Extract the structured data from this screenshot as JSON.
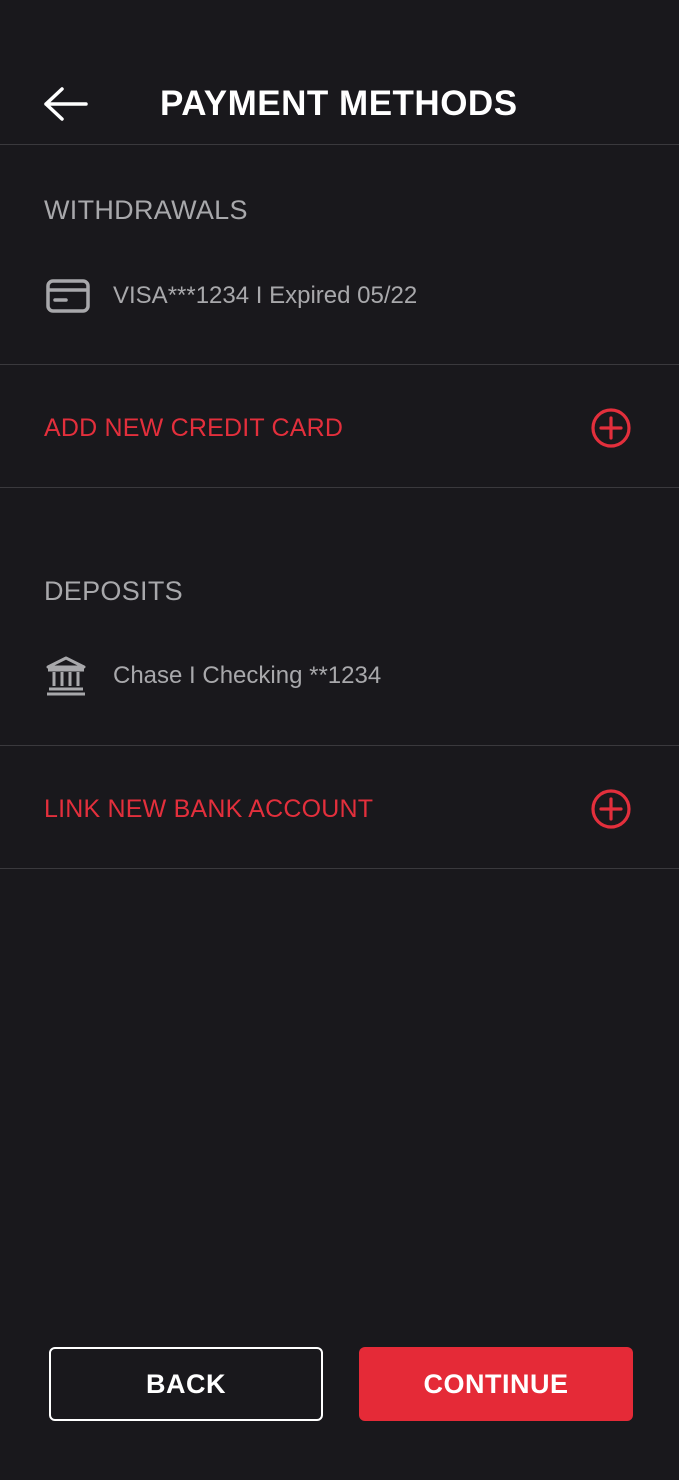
{
  "header": {
    "title": "PAYMENT METHODS",
    "back_icon": "arrow-left-icon"
  },
  "withdrawals": {
    "section_title": "WITHDRAWALS",
    "methods": [
      {
        "icon": "credit-card-icon",
        "label": "VISA***1234 I Expired 05/22"
      }
    ],
    "add_label": "ADD NEW CREDIT CARD",
    "add_icon": "plus-circle-icon"
  },
  "deposits": {
    "section_title": "DEPOSITS",
    "methods": [
      {
        "icon": "bank-icon",
        "label": "Chase I Checking **1234"
      }
    ],
    "add_label": "LINK NEW BANK ACCOUNT",
    "add_icon": "plus-circle-icon"
  },
  "footer": {
    "back_label": "BACK",
    "continue_label": "CONTINUE"
  },
  "colors": {
    "background": "#19181c",
    "accent": "#e52a37",
    "muted_text": "#a8a8ab",
    "divider": "#3a393d"
  }
}
